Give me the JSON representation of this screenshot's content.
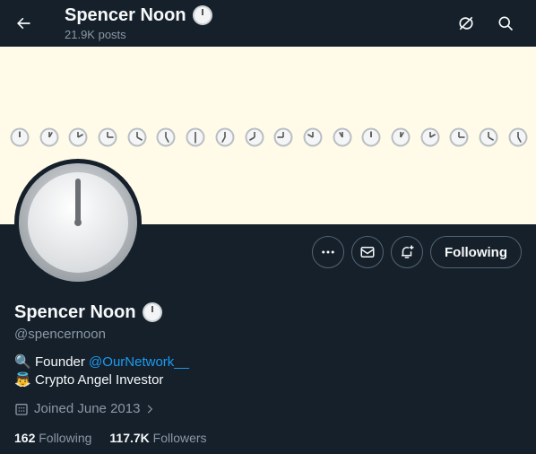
{
  "header": {
    "title": "Spencer Noon",
    "posts": "21.9K posts"
  },
  "actions": {
    "following_label": "Following"
  },
  "profile": {
    "name": "Spencer Noon",
    "handle": "@spencernoon",
    "bio": [
      {
        "icon": "magnifying-glass-emoji",
        "prefix": "Founder ",
        "link": "@OurNetwork__",
        "suffix": ""
      },
      {
        "icon": "angel-emoji",
        "prefix": "Crypto Angel Investor",
        "link": "",
        "suffix": ""
      }
    ],
    "joined": "Joined June 2013",
    "following_count": "162",
    "following_label": "Following",
    "followers_count": "117.7K",
    "followers_label": "Followers"
  },
  "colors": {
    "background": "#15202b",
    "banner": "#fffbe8",
    "accent": "#1d9bf0",
    "muted": "#8b98a5"
  },
  "icons": [
    "back-arrow-icon",
    "clock-emoji-icon",
    "no-repost-icon",
    "search-icon",
    "more-icon",
    "mail-icon",
    "bell-plus-icon",
    "calendar-icon",
    "chevron-right-icon"
  ]
}
